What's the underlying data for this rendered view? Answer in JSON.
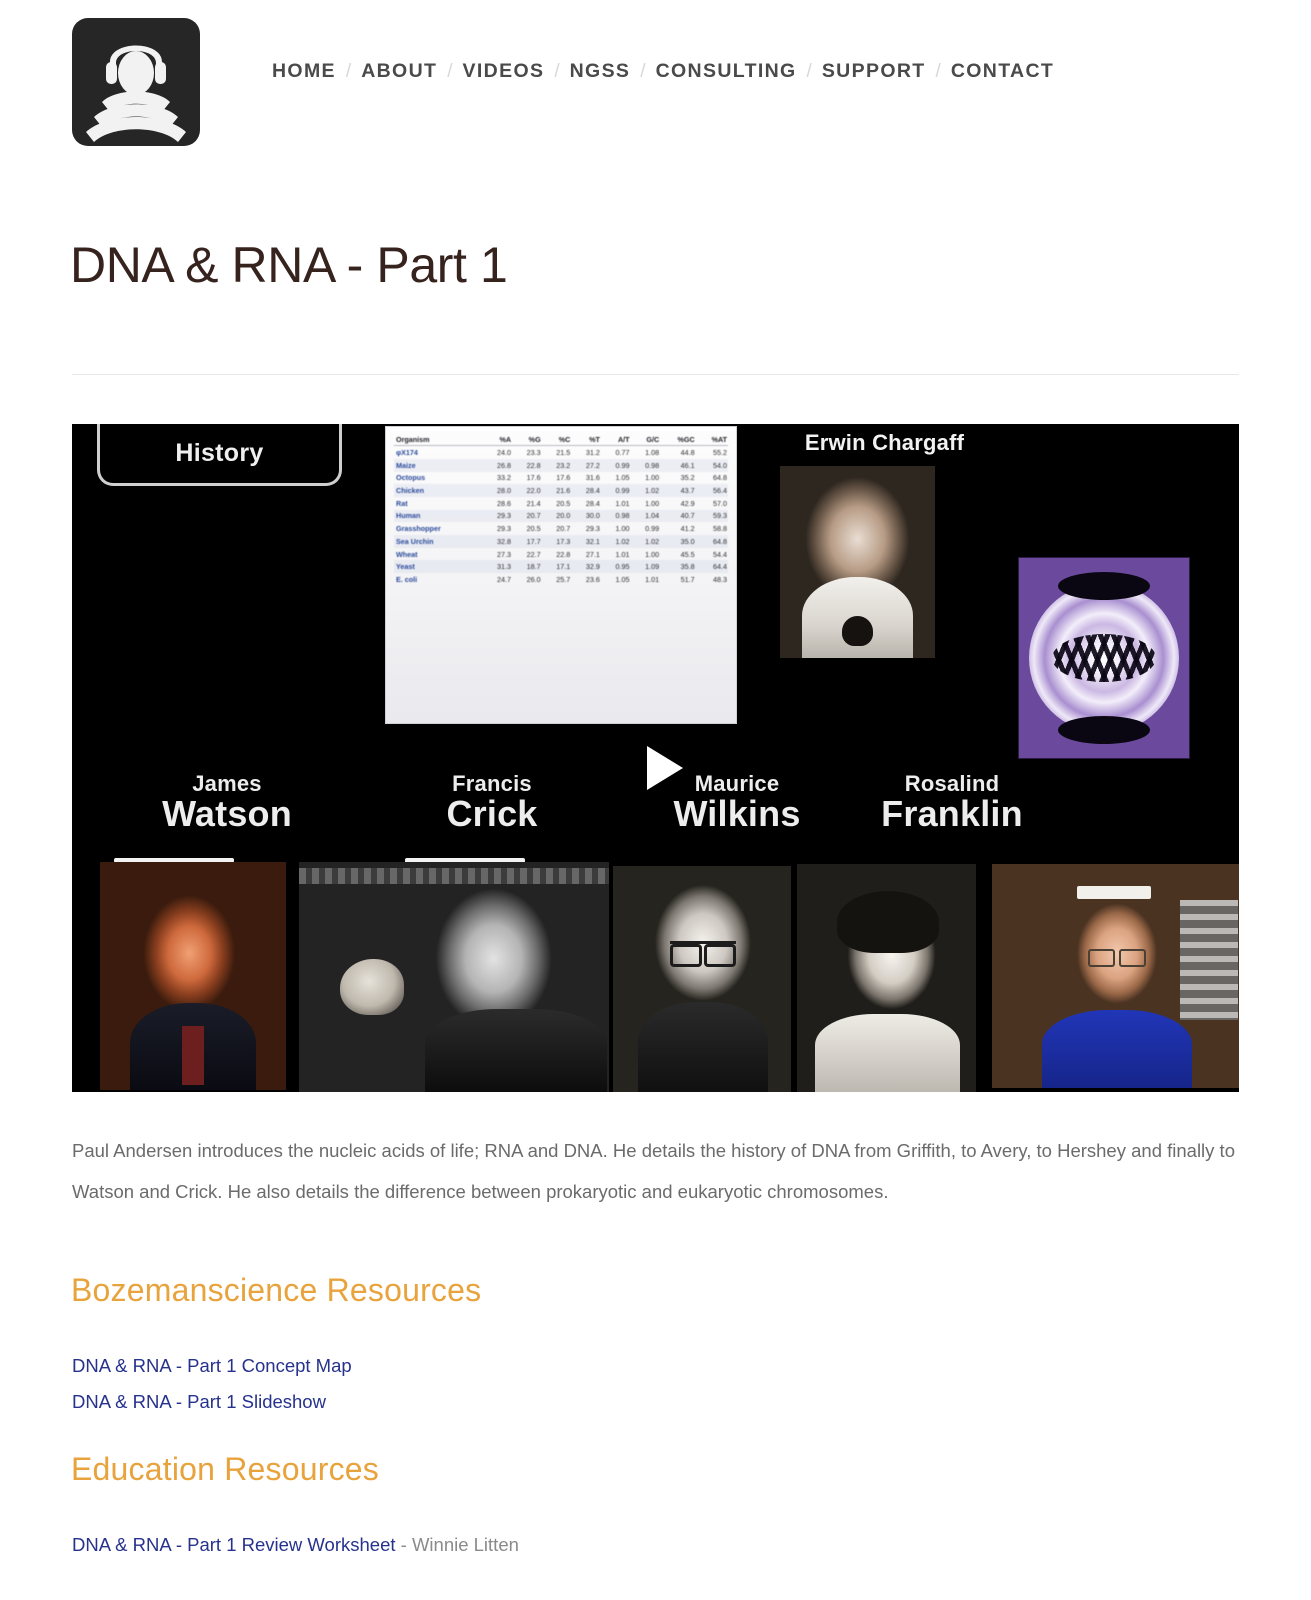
{
  "header": {
    "logo": {
      "name": "bozemanscience-logo",
      "alt": "Bozemanscience headphones logo"
    },
    "nav": [
      {
        "label": "HOME"
      },
      {
        "label": "ABOUT"
      },
      {
        "label": "VIDEOS"
      },
      {
        "label": "NGSS"
      },
      {
        "label": "CONSULTING"
      },
      {
        "label": "SUPPORT"
      },
      {
        "label": "CONTACT"
      }
    ],
    "nav_separator": "/"
  },
  "page": {
    "title": "DNA & RNA - Part 1"
  },
  "video": {
    "overlay_title": "History",
    "chargaff_label": "Erwin Chargaff",
    "play_label": "Play",
    "scientists": [
      {
        "first": "James",
        "last": "Watson"
      },
      {
        "first": "Francis",
        "last": "Crick"
      },
      {
        "first": "Maurice",
        "last": "Wilkins"
      },
      {
        "first": "Rosalind",
        "last": "Franklin"
      }
    ],
    "chargaff_table": {
      "columns": [
        "Organism",
        "%A",
        "%G",
        "%C",
        "%T",
        "A/T",
        "G/C",
        "%GC",
        "%AT"
      ],
      "rows": [
        [
          "φX174",
          "24.0",
          "23.3",
          "21.5",
          "31.2",
          "0.77",
          "1.08",
          "44.8",
          "55.2"
        ],
        [
          "Maize",
          "26.8",
          "22.8",
          "23.2",
          "27.2",
          "0.99",
          "0.98",
          "46.1",
          "54.0"
        ],
        [
          "Octopus",
          "33.2",
          "17.6",
          "17.6",
          "31.6",
          "1.05",
          "1.00",
          "35.2",
          "64.8"
        ],
        [
          "Chicken",
          "28.0",
          "22.0",
          "21.6",
          "28.4",
          "0.99",
          "1.02",
          "43.7",
          "56.4"
        ],
        [
          "Rat",
          "28.6",
          "21.4",
          "20.5",
          "28.4",
          "1.01",
          "1.00",
          "42.9",
          "57.0"
        ],
        [
          "Human",
          "29.3",
          "20.7",
          "20.0",
          "30.0",
          "0.98",
          "1.04",
          "40.7",
          "59.3"
        ],
        [
          "Grasshopper",
          "29.3",
          "20.5",
          "20.7",
          "29.3",
          "1.00",
          "0.99",
          "41.2",
          "58.8"
        ],
        [
          "Sea Urchin",
          "32.8",
          "17.7",
          "17.3",
          "32.1",
          "1.02",
          "1.02",
          "35.0",
          "64.8"
        ],
        [
          "Wheat",
          "27.3",
          "22.7",
          "22.8",
          "27.1",
          "1.01",
          "1.00",
          "45.5",
          "54.4"
        ],
        [
          "Yeast",
          "31.3",
          "18.7",
          "17.1",
          "32.9",
          "0.95",
          "1.09",
          "35.8",
          "64.4"
        ],
        [
          "E. coli",
          "24.7",
          "26.0",
          "25.7",
          "23.6",
          "1.05",
          "1.01",
          "51.7",
          "48.3"
        ]
      ]
    }
  },
  "description": "Paul Andersen introduces the nucleic acids of life; RNA and DNA. He details the history of DNA from Griffith, to Avery, to Hershey and finally to Watson and Crick. He also details the difference between prokaryotic and eukaryotic chromosomes.",
  "sections": {
    "bozeman": {
      "heading": "Bozemanscience Resources",
      "links": [
        {
          "text": "DNA & RNA - Part 1 Concept Map",
          "author": ""
        },
        {
          "text": "DNA & RNA - Part 1 Slideshow",
          "author": ""
        }
      ]
    },
    "education": {
      "heading": "Education Resources",
      "links": [
        {
          "text": "DNA & RNA - Part 1 Review Worksheet",
          "author": " - Winnie Litten"
        }
      ]
    }
  },
  "colors": {
    "accent_orange": "#e8a33d",
    "link_blue": "#26328c",
    "title_brown": "#36231d",
    "nav_gray": "#4a4a4a",
    "body_gray": "#6b6b6b",
    "logo_bg": "#262626"
  }
}
